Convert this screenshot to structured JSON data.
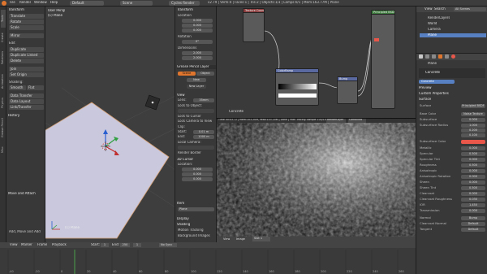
{
  "topbar": {
    "menus": [
      "File",
      "Render",
      "Window",
      "Help"
    ],
    "screen": "Default",
    "scene": "Scene",
    "engine": "Cycles Render",
    "info": "v2.79 | Verts:4 | Faces:1 | Tris:2 | Objects:1/3 | Lamps:0/1 | Mem:163.77M | Plane"
  },
  "left_tabs": [
    "Tools",
    "Create",
    "Relations",
    "Animation",
    "Physics",
    "Grease Pencil",
    "Misc"
  ],
  "toolshelf": {
    "header": "Transform",
    "items": [
      "Translate",
      "Rotate",
      "Scale",
      "",
      "Mirror",
      "",
      "Edit",
      "Duplicate",
      "Duplicate Linked",
      "Delete",
      "",
      "Join",
      "Set Origin",
      "",
      "Shading:",
      "Smooth",
      "Flat",
      "",
      "Data Transfer",
      "Data Layout",
      "Link/Transfer",
      "",
      "History"
    ],
    "bottom_header": "Move and Attach",
    "bottom_items": [
      "Add, Move and Add"
    ],
    "mode": "Object Mode"
  },
  "viewport": {
    "top_left_1": "User Persp",
    "top_left_2": "(1) Plane",
    "object_label": "(1) Plane"
  },
  "npanel": {
    "header": "Transform",
    "fields": [
      {
        "label": "Location",
        "x": "0.000",
        "y": "0.000",
        "z": "0.000"
      },
      {
        "label": "Rotation",
        "x": "0°",
        "y": "0°",
        "z": "0°"
      },
      {
        "label": "Dimensions",
        "x": "2.000",
        "y": "2.000",
        "z": "0.000"
      }
    ],
    "grease_header": "Grease Pencil Layer",
    "scene_btn": "Scene",
    "object_btn": "Object",
    "new_btn": "New",
    "new_layer": "New Layer",
    "view_header": "View",
    "lens_label": "Lens:",
    "lens_val": "35mm",
    "lock_obj": "Lock to Object:",
    "lock_cursor": "Lock to Cursor",
    "lock_cam": "Lock Camera to View",
    "clip": "Clip:",
    "start": "Start:",
    "start_val": "0.01 m",
    "end": "End:",
    "end_val": "1000 m",
    "local_cam": "Local Camera:",
    "render_border": "Render Border",
    "cursor_header": "3D Cursor",
    "location": "Location:",
    "items_header": "Item",
    "plane": "Plane",
    "display": "Display",
    "shading": "Shading",
    "motion": "Motion Tracking",
    "background": "Background Images"
  },
  "node_editor": {
    "nodes": [
      {
        "title": "Texture Coordinate",
        "id": "node-texcoord"
      },
      {
        "title": "ColorRamp",
        "id": "node-colorramp"
      },
      {
        "title": "Bump",
        "id": "node-bump"
      },
      {
        "title": "Principled BSDF",
        "id": "node-principled"
      },
      {
        "title": "Noise Texture",
        "id": "node-noise"
      }
    ],
    "bottom_label": "Concrete"
  },
  "renderview": {
    "header": "Time 00:03.72 | Mem:103.20M, Peak:103.20M | Done | Path Tracing Sample 100/100",
    "view": "View",
    "image": "Image",
    "slot": "Slot 1",
    "layer": "RenderLayer",
    "combined": "Combined",
    "bottom_mode": "Object Mode",
    "bottom_view": "View",
    "bottom_select": "Select",
    "bottom_add": "Add",
    "bottom_object": "Object",
    "bottom_render": "Rendered",
    "bottom_global": "Global"
  },
  "outliner": {
    "view": "View",
    "search": "Search",
    "scope": "All Scenes",
    "items": [
      "RenderLayers",
      "World",
      "Camera",
      "Plane"
    ]
  },
  "properties": {
    "tabs_label": "Plane",
    "material_name": "Concrete",
    "preview": "Preview",
    "custom": "Custom Properties",
    "surface_header": "Surface",
    "surface_label": "Surface",
    "surface_val": "Principled BSDF",
    "rows": [
      {
        "label": "Base Color",
        "val": "Noise Texture"
      },
      {
        "label": "Subsurface",
        "val": "0.000"
      },
      {
        "label": "Subsurface Radius",
        "val": "1.000"
      },
      {
        "label": "",
        "val": "0.200"
      },
      {
        "label": "",
        "val": "0.100"
      },
      {
        "label": "Subsurface Color",
        "val": ""
      },
      {
        "label": "Metallic",
        "val": "0.000"
      },
      {
        "label": "Specular",
        "val": "0.500"
      },
      {
        "label": "Specular Tint",
        "val": "0.000"
      },
      {
        "label": "Roughness",
        "val": "0.500"
      },
      {
        "label": "Anisotropic",
        "val": "0.000"
      },
      {
        "label": "Anisotropic Rotation",
        "val": "0.000"
      },
      {
        "label": "Sheen",
        "val": "0.000"
      },
      {
        "label": "Sheen Tint",
        "val": "0.500"
      },
      {
        "label": "Clearcoat",
        "val": "0.000"
      },
      {
        "label": "Clearcoat Roughness",
        "val": "0.030"
      },
      {
        "label": "IOR",
        "val": "1.450"
      },
      {
        "label": "Transmission",
        "val": "0.000"
      }
    ],
    "normal_label": "Normal",
    "normal_val": "Bump",
    "clearcoat_normal": "Clearcoat Normal",
    "clearcoat_normal_val": "Default",
    "tangent": "Tangent",
    "tangent_val": "Default",
    "subsurface_color_hex": "#e8574a"
  },
  "timeline": {
    "view": "View",
    "marker": "Marker",
    "frame": "Frame",
    "playback": "Playback",
    "start_label": "Start:",
    "start_val": "1",
    "end_label": "End:",
    "end_val": "250",
    "current": "1",
    "sync": "No Sync",
    "ticks": [
      "-40",
      "-20",
      "0",
      "20",
      "40",
      "60",
      "80",
      "100",
      "120",
      "140",
      "160",
      "180",
      "200",
      "220",
      "240",
      "260"
    ]
  },
  "colors": {
    "accent": "#e0762e",
    "active": "#5680c2",
    "selected_obj": "#f0a35a"
  }
}
